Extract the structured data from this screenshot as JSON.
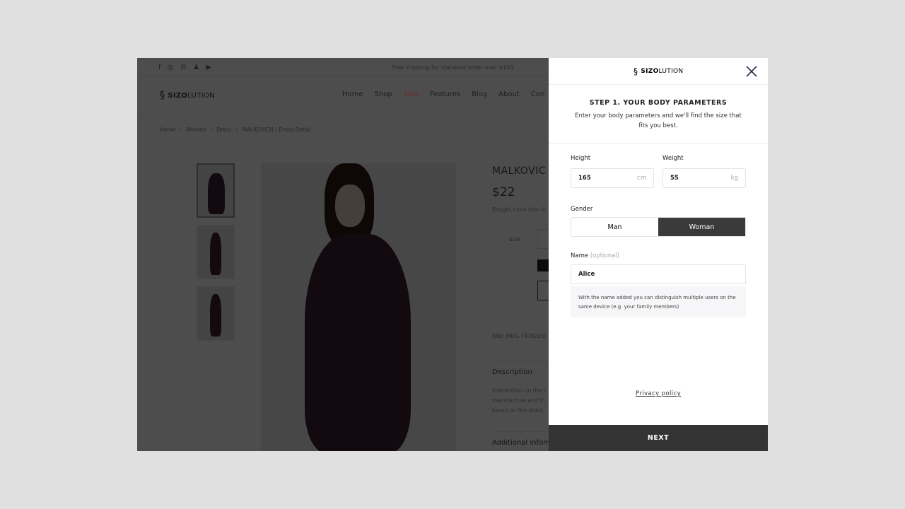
{
  "shop": {
    "social_icons": [
      "facebook-icon",
      "instagram-icon",
      "pinterest-icon",
      "snapchat-icon",
      "youtube-icon"
    ],
    "shipping_notice": "Free shipping for standard order over $100",
    "logo": {
      "bold": "SIZO",
      "rest": "LUTION"
    },
    "menu": [
      "Home",
      "Shop",
      "Sale",
      "Features",
      "Blog",
      "About",
      "Con"
    ],
    "breadcrumb": [
      "Home",
      "Women",
      "Dress",
      "MALKOVICH / Dress Detail"
    ],
    "product": {
      "title": "MALKOVIC",
      "price": "$22",
      "bought": "Bought more than 6",
      "size_label": "Size",
      "sku": "SKU: MUG-747822hi",
      "description_title": "Description",
      "description": [
        "Information on the t",
        "manufacture and th",
        "based on the latest"
      ],
      "additional": "Additional inforr"
    }
  },
  "panel": {
    "logo": {
      "bold": "SIZO",
      "rest": "LUTION"
    },
    "step_title": "STEP 1. YOUR BODY PARAMETERS",
    "step_subtitle": "Enter your body parameters and we'll find the size that fits you best.",
    "height": {
      "label": "Height",
      "value": "165",
      "unit": "cm"
    },
    "weight": {
      "label": "Weight",
      "value": "55",
      "unit": "kg"
    },
    "gender": {
      "label": "Gender",
      "options": [
        "Man",
        "Woman"
      ],
      "selected": "Woman"
    },
    "name": {
      "label": "Name",
      "optional": "(optional)",
      "value": "Alice"
    },
    "hint": "With the name added you can distinguish multiple users on the same device (e.g. your family members)",
    "privacy": "Privacy policy",
    "next": "NEXT"
  }
}
